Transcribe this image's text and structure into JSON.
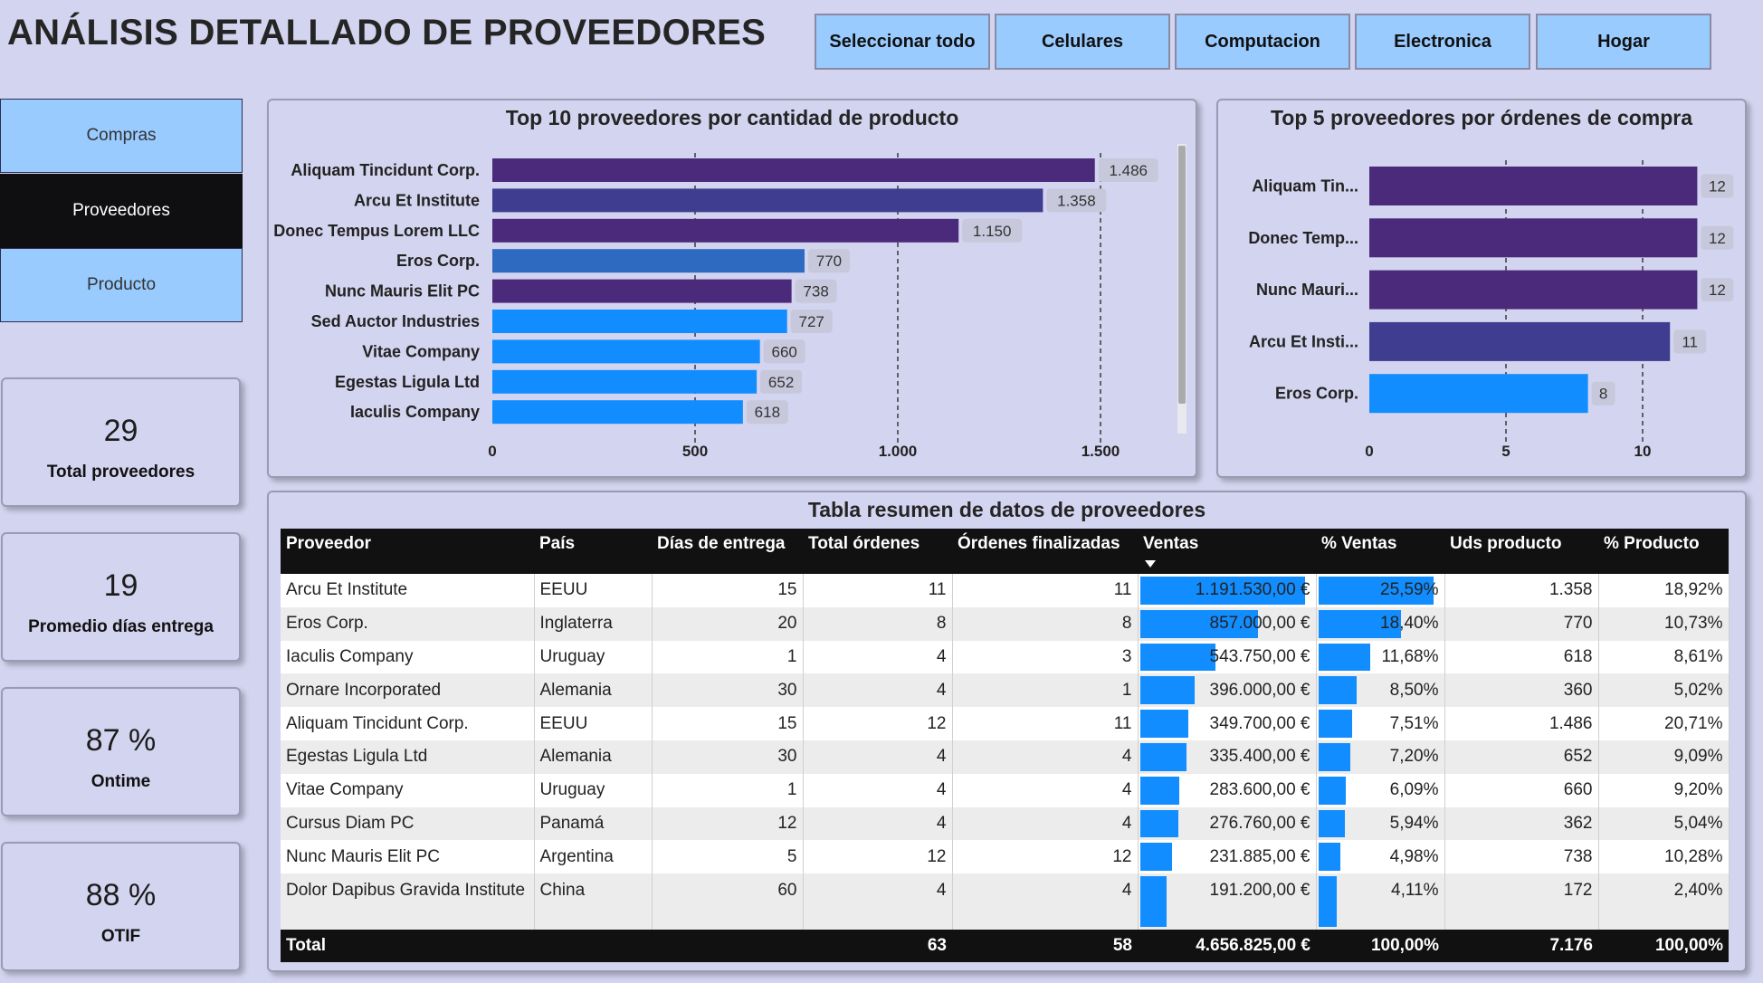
{
  "page_title": "ANÁLISIS DETALLADO DE PROVEEDORES",
  "filters": [
    "Seleccionar todo",
    "Celulares",
    "Computacion",
    "Electronica",
    "Hogar"
  ],
  "nav": [
    {
      "label": "Compras",
      "active": false
    },
    {
      "label": "Proveedores",
      "active": true
    },
    {
      "label": "Producto",
      "active": false
    }
  ],
  "kpis": [
    {
      "value": "29",
      "label": "Total proveedores"
    },
    {
      "value": "19",
      "label": "Promedio días entrega"
    },
    {
      "value": "87 %",
      "label": "Ontime"
    },
    {
      "value": "88 %",
      "label": "OTIF"
    }
  ],
  "chart_data": [
    {
      "type": "bar",
      "orientation": "horizontal",
      "title": "Top 10 proveedores por cantidad de producto",
      "categories": [
        "Aliquam Tincidunt Corp.",
        "Arcu Et Institute",
        "Donec Tempus Lorem LLC",
        "Eros Corp.",
        "Nunc Mauris Elit PC",
        "Sed Auctor Industries",
        "Vitae Company",
        "Egestas Ligula Ltd",
        "Iaculis Company"
      ],
      "values": [
        1486,
        1358,
        1150,
        770,
        738,
        727,
        660,
        652,
        618
      ],
      "data_labels": [
        "1.486",
        "1.358",
        "1.150",
        "770",
        "738",
        "727",
        "660",
        "652",
        "618"
      ],
      "colors": [
        "#4b2a7b",
        "#3e3d8f",
        "#4b2a7b",
        "#2e6ac0",
        "#4b2a7b",
        "#118dff",
        "#118dff",
        "#118dff",
        "#118dff"
      ],
      "xlim": [
        0,
        1500
      ],
      "xticks": [
        0,
        500,
        1000,
        1500
      ],
      "xtick_labels": [
        "0",
        "500",
        "1.000",
        "1.500"
      ],
      "grid": true
    },
    {
      "type": "bar",
      "orientation": "horizontal",
      "title": "Top 5 proveedores por órdenes de compra",
      "categories": [
        "Aliquam Tin...",
        "Donec Temp...",
        "Nunc Mauri...",
        "Arcu Et Insti...",
        "Eros Corp."
      ],
      "values": [
        12,
        12,
        12,
        11,
        8
      ],
      "data_labels": [
        "12",
        "12",
        "12",
        "11",
        "8"
      ],
      "colors": [
        "#4b2a7b",
        "#4b2a7b",
        "#4b2a7b",
        "#3e3d8f",
        "#118dff"
      ],
      "xlim": [
        0,
        10
      ],
      "xticks": [
        0,
        5,
        10
      ],
      "xtick_labels": [
        "0",
        "5",
        "10"
      ],
      "grid": true
    }
  ],
  "table": {
    "title": "Tabla resumen de datos de proveedores",
    "columns": [
      "Proveedor",
      "País",
      "Días de entrega",
      "Total órdenes",
      "Órdenes finalizadas",
      "Ventas",
      "% Ventas",
      "Uds producto",
      "% Producto"
    ],
    "rows": [
      {
        "proveedor": "Arcu Et Institute",
        "pais": "EEUU",
        "dias": "15",
        "ordenes": "11",
        "finalizadas": "11",
        "ventas": "1.191.530,00 €",
        "ventas_n": 1191530,
        "pct_ventas": "25,59%",
        "pct_ventas_n": 25.59,
        "uds": "1.358",
        "pct_producto": "18,92%"
      },
      {
        "proveedor": "Eros Corp.",
        "pais": "Inglaterra",
        "dias": "20",
        "ordenes": "8",
        "finalizadas": "8",
        "ventas": "857.000,00 €",
        "ventas_n": 857000,
        "pct_ventas": "18,40%",
        "pct_ventas_n": 18.4,
        "uds": "770",
        "pct_producto": "10,73%"
      },
      {
        "proveedor": "Iaculis Company",
        "pais": "Uruguay",
        "dias": "1",
        "ordenes": "4",
        "finalizadas": "3",
        "ventas": "543.750,00 €",
        "ventas_n": 543750,
        "pct_ventas": "11,68%",
        "pct_ventas_n": 11.68,
        "uds": "618",
        "pct_producto": "8,61%"
      },
      {
        "proveedor": "Ornare Incorporated",
        "pais": "Alemania",
        "dias": "30",
        "ordenes": "4",
        "finalizadas": "1",
        "ventas": "396.000,00 €",
        "ventas_n": 396000,
        "pct_ventas": "8,50%",
        "pct_ventas_n": 8.5,
        "uds": "360",
        "pct_producto": "5,02%"
      },
      {
        "proveedor": "Aliquam Tincidunt Corp.",
        "pais": "EEUU",
        "dias": "15",
        "ordenes": "12",
        "finalizadas": "11",
        "ventas": "349.700,00 €",
        "ventas_n": 349700,
        "pct_ventas": "7,51%",
        "pct_ventas_n": 7.51,
        "uds": "1.486",
        "pct_producto": "20,71%"
      },
      {
        "proveedor": "Egestas Ligula Ltd",
        "pais": "Alemania",
        "dias": "30",
        "ordenes": "4",
        "finalizadas": "4",
        "ventas": "335.400,00 €",
        "ventas_n": 335400,
        "pct_ventas": "7,20%",
        "pct_ventas_n": 7.2,
        "uds": "652",
        "pct_producto": "9,09%"
      },
      {
        "proveedor": "Vitae Company",
        "pais": "Uruguay",
        "dias": "1",
        "ordenes": "4",
        "finalizadas": "4",
        "ventas": "283.600,00 €",
        "ventas_n": 283600,
        "pct_ventas": "6,09%",
        "pct_ventas_n": 6.09,
        "uds": "660",
        "pct_producto": "9,20%"
      },
      {
        "proveedor": "Cursus Diam PC",
        "pais": "Panamá",
        "dias": "12",
        "ordenes": "4",
        "finalizadas": "4",
        "ventas": "276.760,00 €",
        "ventas_n": 276760,
        "pct_ventas": "5,94%",
        "pct_ventas_n": 5.94,
        "uds": "362",
        "pct_producto": "5,04%"
      },
      {
        "proveedor": "Nunc Mauris Elit PC",
        "pais": "Argentina",
        "dias": "5",
        "ordenes": "12",
        "finalizadas": "12",
        "ventas": "231.885,00 €",
        "ventas_n": 231885,
        "pct_ventas": "4,98%",
        "pct_ventas_n": 4.98,
        "uds": "738",
        "pct_producto": "10,28%"
      },
      {
        "proveedor": "Dolor Dapibus Gravida Institute",
        "pais": "China",
        "dias": "60",
        "ordenes": "4",
        "finalizadas": "4",
        "ventas": "191.200,00 €",
        "ventas_n": 191200,
        "pct_ventas": "4,11%",
        "pct_ventas_n": 4.11,
        "uds": "172",
        "pct_producto": "2,40%"
      }
    ],
    "total": {
      "label": "Total",
      "pais": "",
      "dias": "",
      "ordenes": "63",
      "finalizadas": "58",
      "ventas": "4.656.825,00 €",
      "pct_ventas": "100,00%",
      "uds": "7.176",
      "pct_producto": "100,00%"
    }
  },
  "colors": {
    "background": "#d3d4ef",
    "accent": "#118dff",
    "purple": "#4b2a7b",
    "indigo": "#3e3d8f",
    "button": "#99cbff"
  }
}
